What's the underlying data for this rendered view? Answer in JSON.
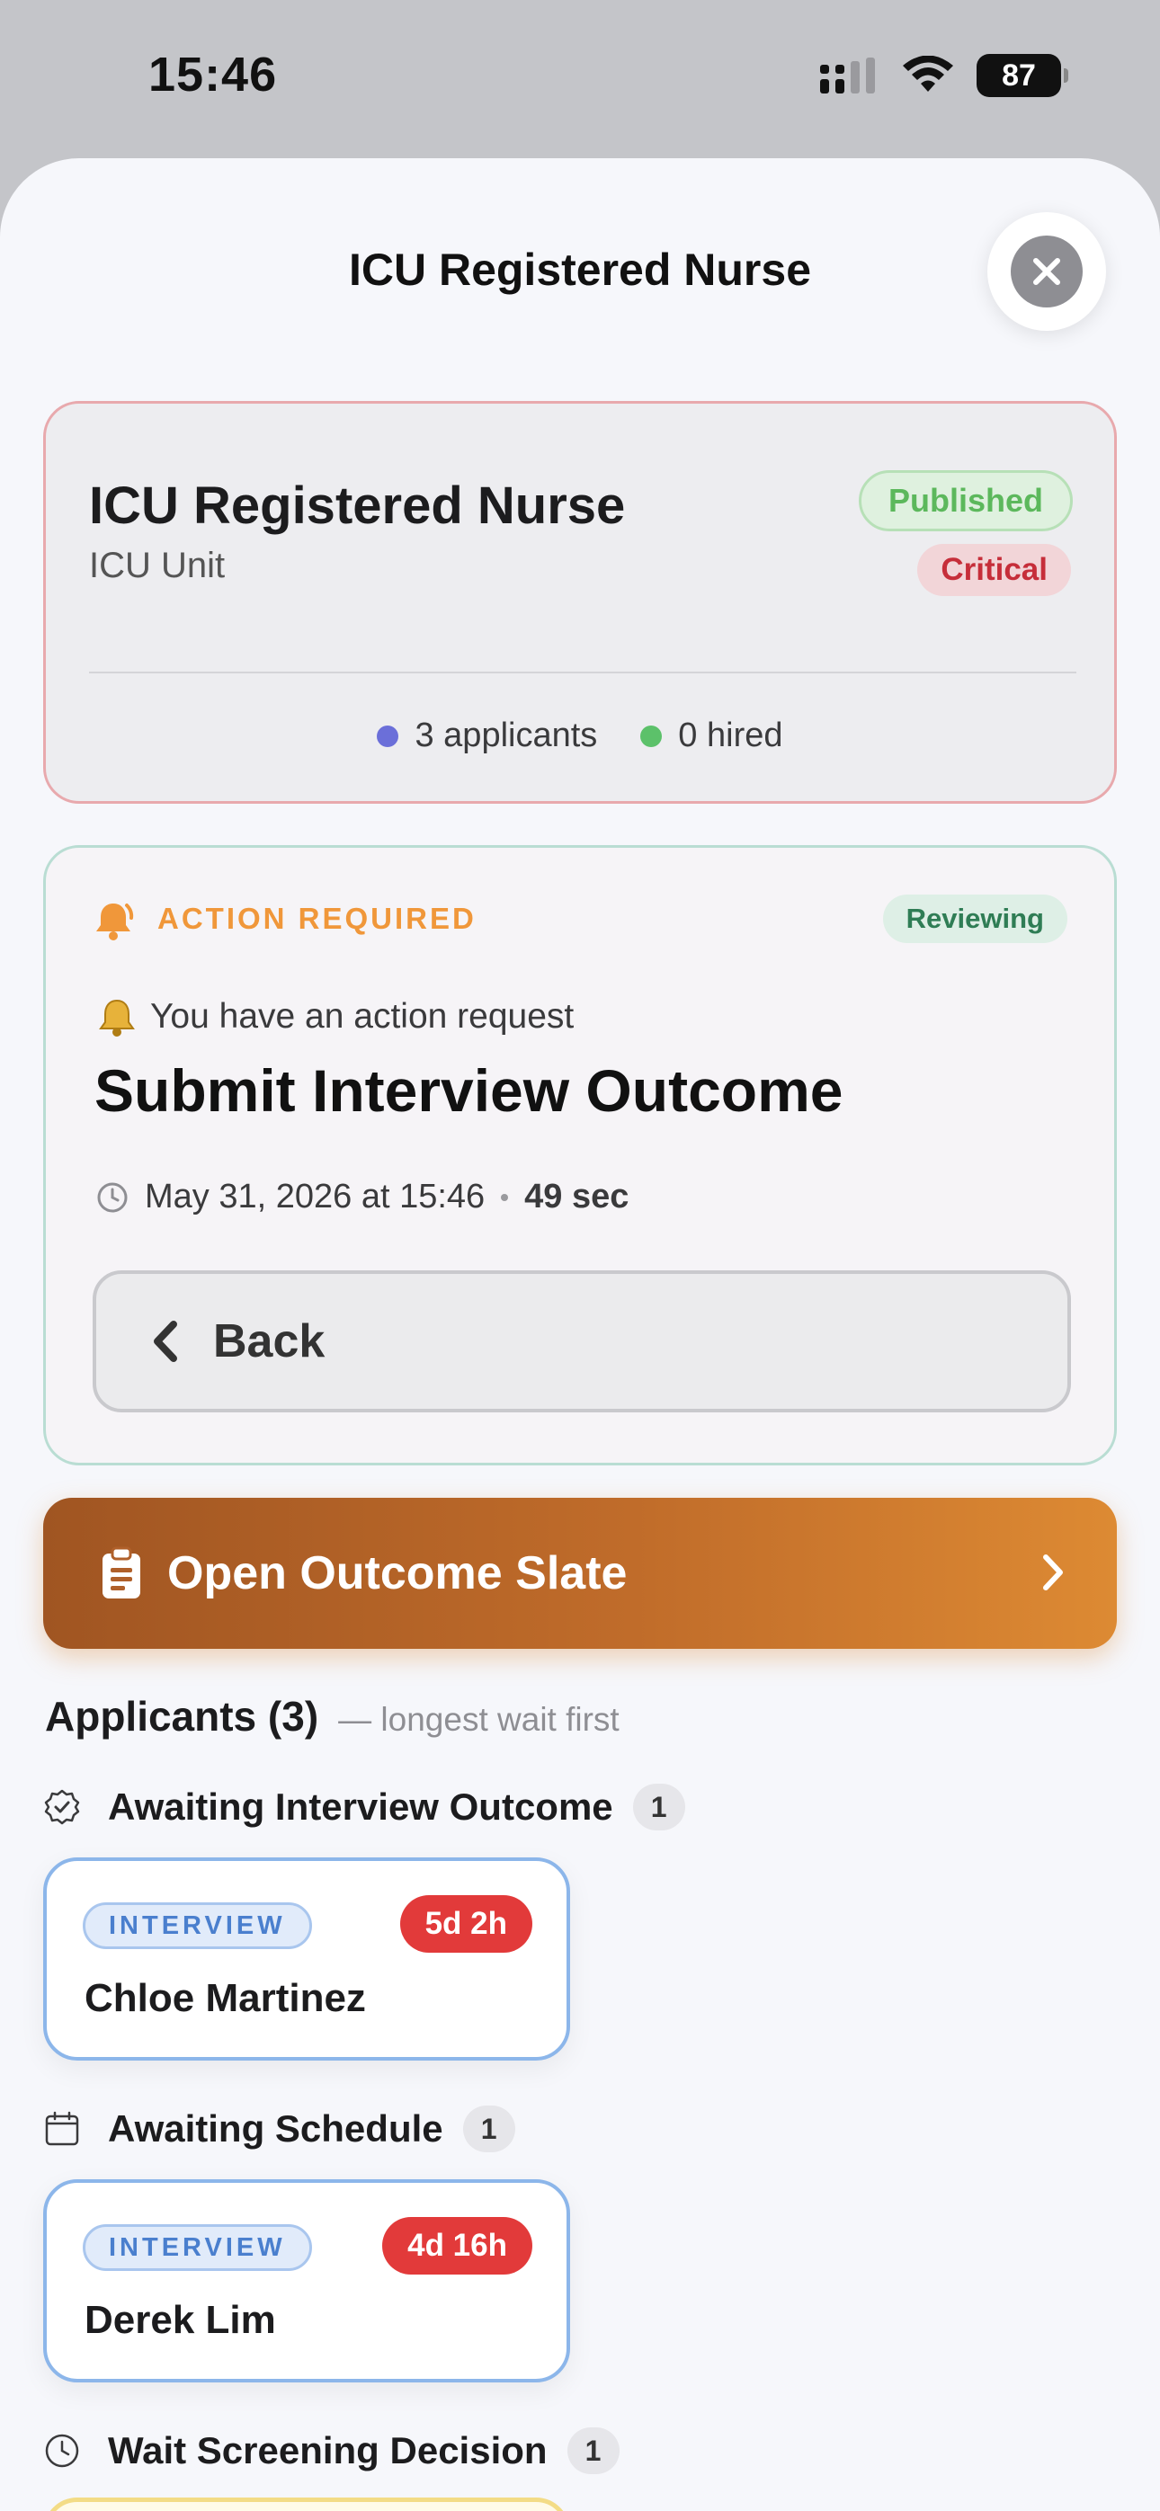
{
  "status_bar": {
    "time": "15:46",
    "battery": "87"
  },
  "sheet": {
    "title": "ICU Registered Nurse"
  },
  "job": {
    "title": "ICU Registered Nurse",
    "unit": "ICU Unit",
    "status_badge": "Published",
    "priority_badge": "Critical",
    "applicants_stat": "3 applicants",
    "hired_stat": "0 hired",
    "colors": {
      "applicants_dot": "#6b6fd9",
      "hired_dot": "#5cc16a"
    }
  },
  "action": {
    "label": "ACTION REQUIRED",
    "status_badge": "Reviewing",
    "request_text": "You have an action request",
    "heading": "Submit Interview Outcome",
    "datetime": "May 31, 2026 at 15:46",
    "duration": "49 sec",
    "back_label": "Back"
  },
  "slate_button": {
    "label": "Open Outcome Slate"
  },
  "applicants": {
    "title": "Applicants (3)",
    "subtitle": "— longest wait first",
    "groups": [
      {
        "title": "Awaiting Interview Outcome",
        "count": "1",
        "icon": "badge-check-icon",
        "items": [
          {
            "stage": "INTERVIEW",
            "wait": "5d 2h",
            "name": "Chloe Martinez"
          }
        ]
      },
      {
        "title": "Awaiting Schedule",
        "count": "1",
        "icon": "calendar-icon",
        "items": [
          {
            "stage": "INTERVIEW",
            "wait": "4d 16h",
            "name": "Derek Lim"
          }
        ]
      },
      {
        "title": "Wait Screening Decision",
        "count": "1",
        "icon": "clock-icon",
        "items": []
      }
    ]
  }
}
